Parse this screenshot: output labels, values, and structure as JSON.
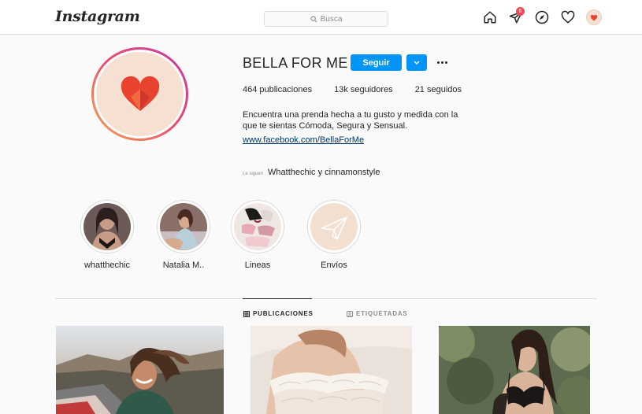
{
  "topbar": {
    "logo": "Instagram",
    "search_placeholder": "Busca",
    "badge_count": "6"
  },
  "profile": {
    "username": "BELLA FOR ME",
    "follow_label": "Seguir",
    "stats": {
      "posts": "464 publicaciones",
      "followers": "13k seguidores",
      "following": "21 seguidos"
    },
    "bio_line1": "Encuentra una prenda hecha a tu gusto y medida con la",
    "bio_line2": "que te sientas Cómoda, Segura y Sensual.",
    "link": "www.facebook.com/BellaForMe",
    "followed_by_label": "Le siguen",
    "followed_by": "Whatthechic y cinnamonstyle"
  },
  "highlights": [
    {
      "label": "whatthechic"
    },
    {
      "label": "Natalia M.."
    },
    {
      "label": "Lineas"
    },
    {
      "label": "Envíos"
    }
  ],
  "tabs": {
    "posts": "PUBLICACIONES",
    "tagged": "ETIQUETADAS"
  },
  "colors": {
    "accent": "#0095f6",
    "badge": "#ed4956",
    "brand_heart": "#e8432e",
    "profile_bg": "#f5e0d1"
  }
}
